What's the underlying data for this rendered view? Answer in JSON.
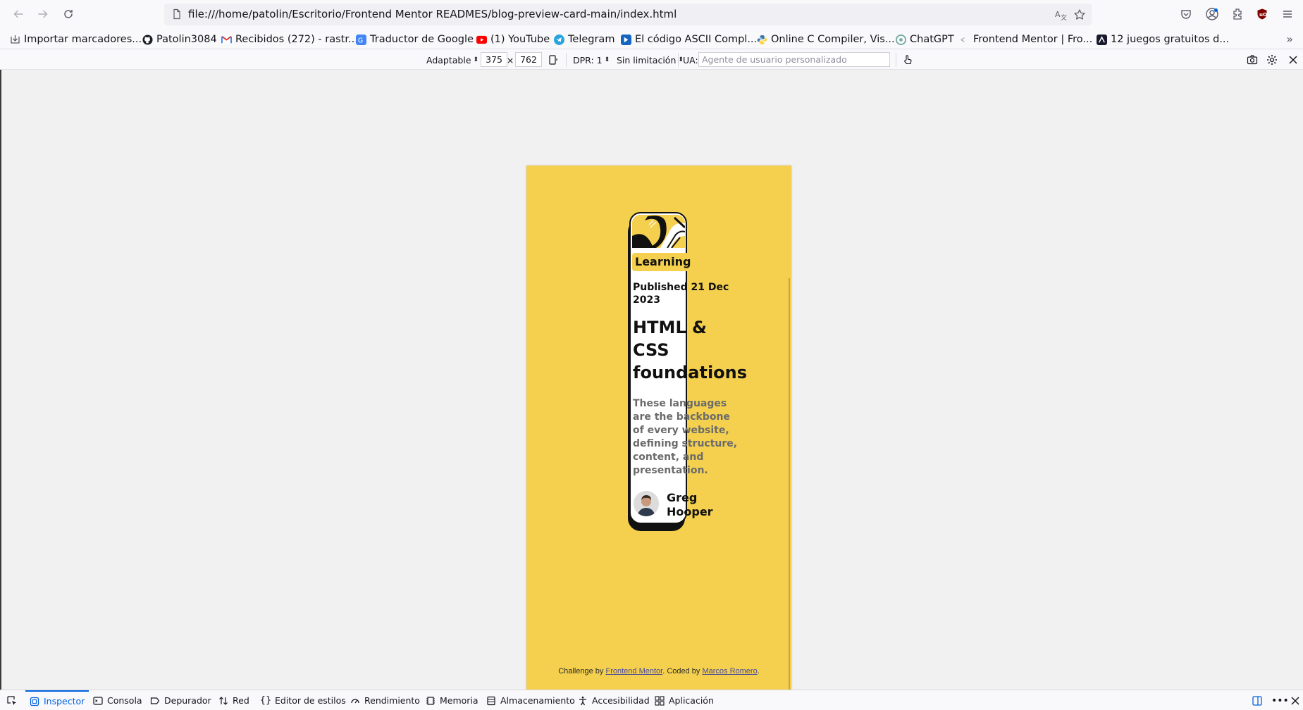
{
  "browser": {
    "url": "file:///home/patolin/Escritorio/Frontend Mentor READMES/blog-preview-card-main/index.html"
  },
  "bookmarks": [
    {
      "label": "Importar marcadores...",
      "icon": "import-icon",
      "color": "#5b5b66"
    },
    {
      "label": "Patolin3084",
      "icon": "github-icon",
      "color": "#1b1f23"
    },
    {
      "label": "Recibidos (272) - rastr...",
      "icon": "gmail-icon",
      "color": "#d93025"
    },
    {
      "label": "Traductor de Google",
      "icon": "translate-icon",
      "color": "#4285f4"
    },
    {
      "label": "(1) YouTube",
      "icon": "youtube-icon",
      "color": "#ff0000"
    },
    {
      "label": "Telegram",
      "icon": "telegram-icon",
      "color": "#2aa3df"
    },
    {
      "label": "El código ASCII Compl...",
      "icon": "ascii-icon",
      "color": "#1565c0"
    },
    {
      "label": "Online C Compiler, Vis...",
      "icon": "python-icon",
      "color": "#3776ab"
    },
    {
      "label": "ChatGPT",
      "icon": "chatgpt-icon",
      "color": "#74aa9c"
    },
    {
      "label": "Frontend Mentor | Fro...",
      "icon": "frontendmentor-icon",
      "color": "#a0a0a8"
    },
    {
      "label": "12 juegos gratuitos d...",
      "icon": "game-icon",
      "color": "#1a1a2e"
    }
  ],
  "rdm": {
    "device": "Adaptable",
    "width": "375",
    "times": "×",
    "height": "762",
    "dpr": "DPR: 1",
    "throttle": "Sin limitación",
    "ua_label": "UA:",
    "ua_placeholder": "Agente de usuario personalizado"
  },
  "card": {
    "tag": "Learning",
    "published": "Published 21 Dec 2023",
    "title": "HTML & CSS foundations",
    "description": "These languages are the backbone of every website, defining structure, content, and presentation.",
    "author": "Greg Hooper"
  },
  "attribution": {
    "prefix": "Challenge by ",
    "link1": "Frontend Mentor",
    "middle": ". Coded by ",
    "link2": "Marcos Romero",
    "suffix": "."
  },
  "devtools": {
    "tabs": [
      {
        "label": "Inspector",
        "icon": "inspector-icon",
        "active": true
      },
      {
        "label": "Consola",
        "icon": "console-icon",
        "active": false
      },
      {
        "label": "Depurador",
        "icon": "debugger-icon",
        "active": false
      },
      {
        "label": "Red",
        "icon": "network-icon",
        "active": false
      },
      {
        "label": "Editor de estilos",
        "icon": "style-editor-icon",
        "active": false
      },
      {
        "label": "Rendimiento",
        "icon": "performance-icon",
        "active": false
      },
      {
        "label": "Memoria",
        "icon": "memory-icon",
        "active": false
      },
      {
        "label": "Almacenamiento",
        "icon": "storage-icon",
        "active": false
      },
      {
        "label": "Accesibilidad",
        "icon": "accessibility-icon",
        "active": false
      },
      {
        "label": "Aplicación",
        "icon": "application-icon",
        "active": false
      }
    ]
  },
  "colors": {
    "card_bg": "#f4d04e",
    "accent": "#0061e0"
  }
}
